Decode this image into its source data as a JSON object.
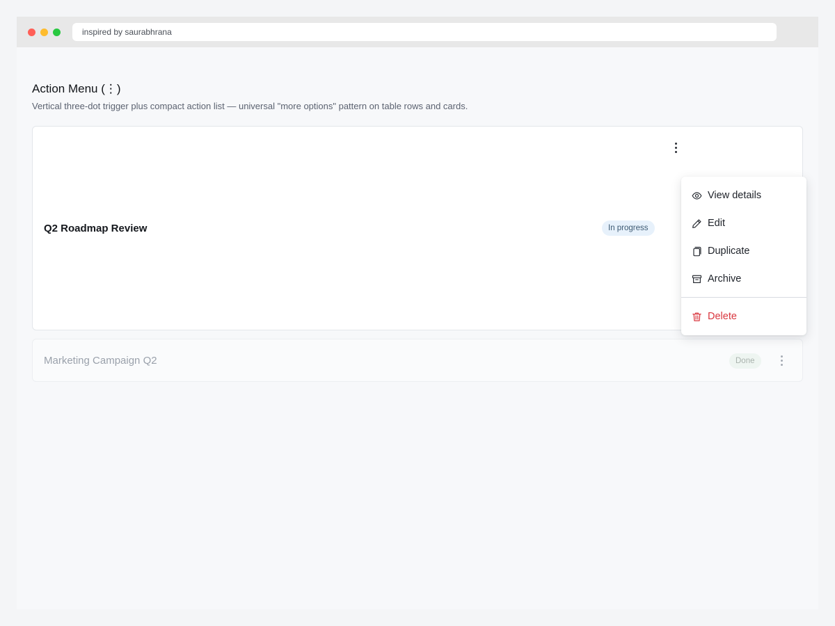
{
  "browser": {
    "address": "inspired by saurabhrana"
  },
  "page": {
    "title": "Action Menu (⋮)",
    "subtitle": "Vertical three-dot trigger plus compact action list — universal \"more options\" pattern on table rows and cards."
  },
  "cards": [
    {
      "title": "Q2 Roadmap Review",
      "status": "In progress"
    },
    {
      "title": "Marketing Campaign Q2",
      "status": "Done"
    }
  ],
  "menu": {
    "items": [
      {
        "label": "View details",
        "icon": "eye-icon"
      },
      {
        "label": "Edit",
        "icon": "pencil-icon"
      },
      {
        "label": "Duplicate",
        "icon": "copy-icon"
      },
      {
        "label": "Archive",
        "icon": "archive-icon"
      }
    ],
    "danger_item": {
      "label": "Delete",
      "icon": "trash-icon"
    }
  },
  "colors": {
    "danger": "#d9363e",
    "badge_in_progress_bg": "#e7f1fb",
    "badge_done_bg": "#eef5f1"
  }
}
